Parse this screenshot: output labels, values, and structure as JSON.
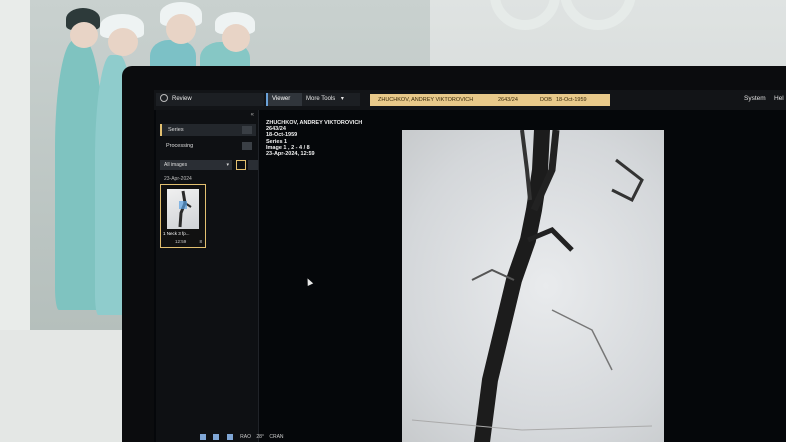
{
  "topbar": {
    "review_label": "Review",
    "viewer_label": "Viewer",
    "more_tools_label": "More Tools",
    "patient_name": "ZHUCHKOV, ANDREY VIKTOROVICH",
    "patient_id": "2643/24",
    "dob_label": "DOB",
    "dob": "18-Oct-1959",
    "system_label": "System",
    "help_label": "Hel"
  },
  "sidebar": {
    "items": [
      {
        "label": "Series"
      },
      {
        "label": "Processing"
      }
    ],
    "filter_label": "All images",
    "date": "23-Apr-2024",
    "thumbnail": {
      "caption": "1 Neck 3 fp...",
      "time": "12:59",
      "count": "8"
    }
  },
  "overlay": {
    "name": "ZHUCHKOV, ANDREY VIKTOROVICH",
    "id": "2643/24",
    "dob": "18-Oct-1959",
    "series": "Series 1",
    "image": "Image 1 , 2 - 4 / 8",
    "datetime": "23-Apr-2024, 12:59"
  },
  "tray": {
    "rao": "RAO",
    "angle": "28°",
    "cran": "CRAN"
  },
  "colors": {
    "accent": "#e3c070",
    "patient_bar": "#e8c98a",
    "screen_bg": "#05070a"
  }
}
